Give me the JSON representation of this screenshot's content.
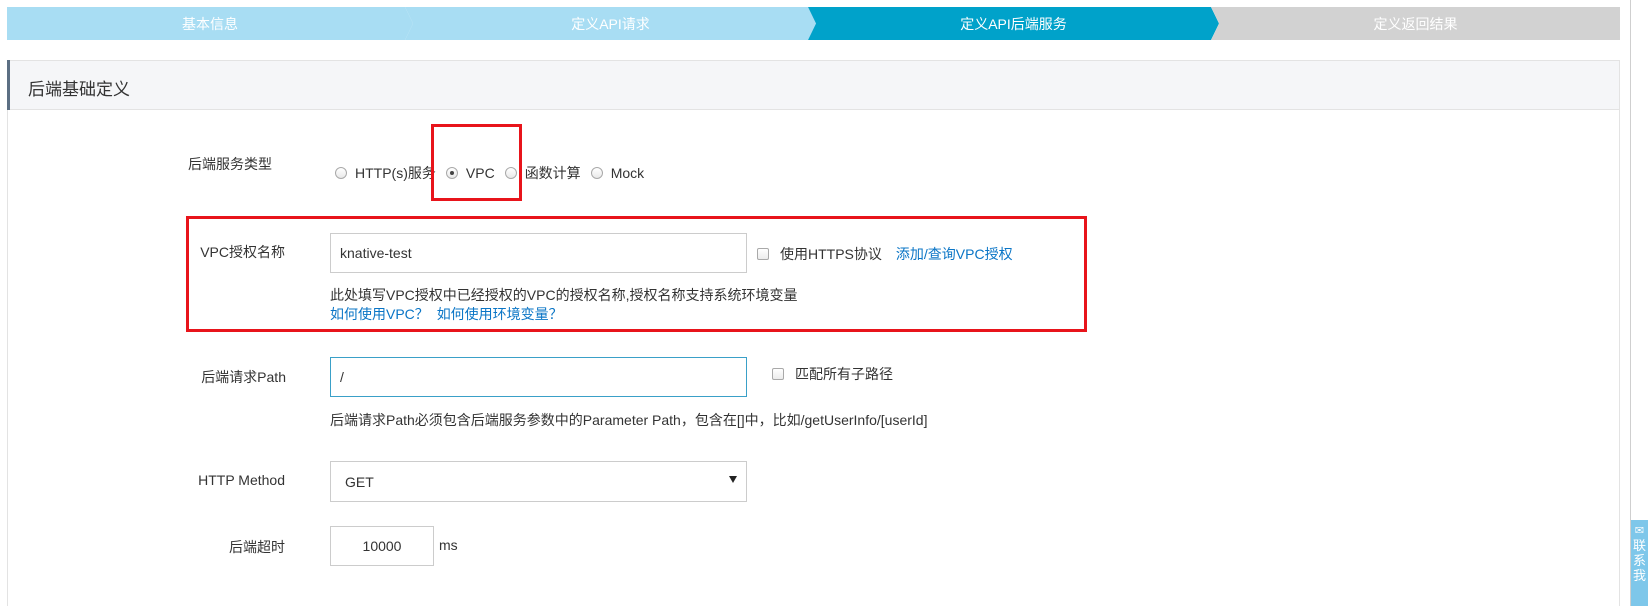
{
  "wizard": {
    "steps": [
      {
        "label": "基本信息",
        "state": "done"
      },
      {
        "label": "定义API请求",
        "state": "done"
      },
      {
        "label": "定义API后端服务",
        "state": "active"
      },
      {
        "label": "定义返回结果",
        "state": "pending"
      }
    ]
  },
  "panel": {
    "title": "后端基础定义"
  },
  "form": {
    "backend_type": {
      "label": "后端服务类型",
      "options": [
        {
          "label": "HTTP(s)服务",
          "checked": false
        },
        {
          "label": "VPC",
          "checked": true
        },
        {
          "label": "函数计算",
          "checked": false
        },
        {
          "label": "Mock",
          "checked": false
        }
      ]
    },
    "vpc_auth": {
      "label": "VPC授权名称",
      "value": "knative-test",
      "https_checkbox_label": "使用HTTPS协议",
      "https_checked": false,
      "add_link": "添加/查询VPC授权",
      "help": "此处填写VPC授权中已经授权的VPC的授权名称,授权名称支持系统环境变量",
      "help_link_vpc": "如何使用VPC？",
      "help_link_env": "如何使用环境变量？"
    },
    "path": {
      "label": "后端请求Path",
      "value": "/",
      "match_subpath_label": "匹配所有子路径",
      "match_subpath_checked": false,
      "help": "后端请求Path必须包含后端服务参数中的Parameter Path，包含在[]中，比如/getUserInfo/[userId]"
    },
    "method": {
      "label": "HTTP Method",
      "value": "GET"
    },
    "timeout": {
      "label": "后端超时",
      "value": "10000",
      "unit": "ms"
    }
  },
  "side_tab": {
    "text": "联系我"
  },
  "colors": {
    "step_done": "#a8ddf3",
    "step_active": "#00a2ca",
    "step_pending": "#d2d2d2",
    "link": "#0a75c6",
    "highlight": "#e8141b"
  },
  "icons": {
    "select_caret": "chevron-down-icon",
    "side_tab_icon": "chat-icon"
  }
}
